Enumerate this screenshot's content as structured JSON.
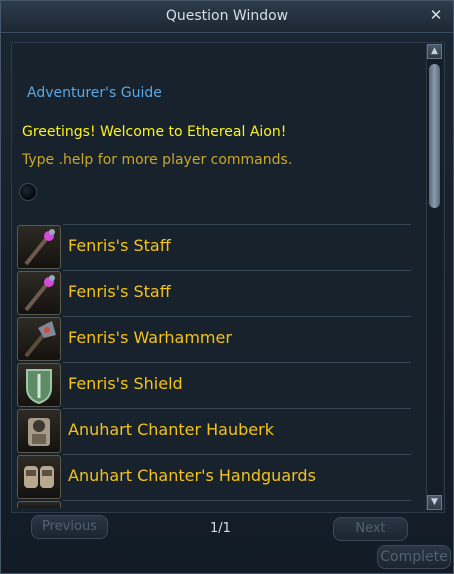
{
  "window": {
    "title": "Question Window",
    "close_icon": "close-icon"
  },
  "content": {
    "guide_link": "Adventurer's Guide",
    "greeting": "Greetings! Welcome to Ethereal Aion!",
    "help": "Type .help for more player commands."
  },
  "items": [
    {
      "name": "Fenris's Staff",
      "icon": "staff-icon"
    },
    {
      "name": "Fenris's Staff",
      "icon": "staff-icon"
    },
    {
      "name": "Fenris's Warhammer",
      "icon": "warhammer-icon"
    },
    {
      "name": "Fenris's Shield",
      "icon": "shield-icon"
    },
    {
      "name": "Anuhart Chanter Hauberk",
      "icon": "hauberk-icon"
    },
    {
      "name": "Anuhart Chanter's Handguards",
      "icon": "handguards-icon"
    }
  ],
  "nav": {
    "previous": "Previous",
    "page": "1/1",
    "next": "Next",
    "complete": "Complete"
  },
  "colors": {
    "link": "#5aa8e4",
    "greeting": "#fbf31e",
    "help": "#c9a72a",
    "item_name": "#f3c31b"
  }
}
